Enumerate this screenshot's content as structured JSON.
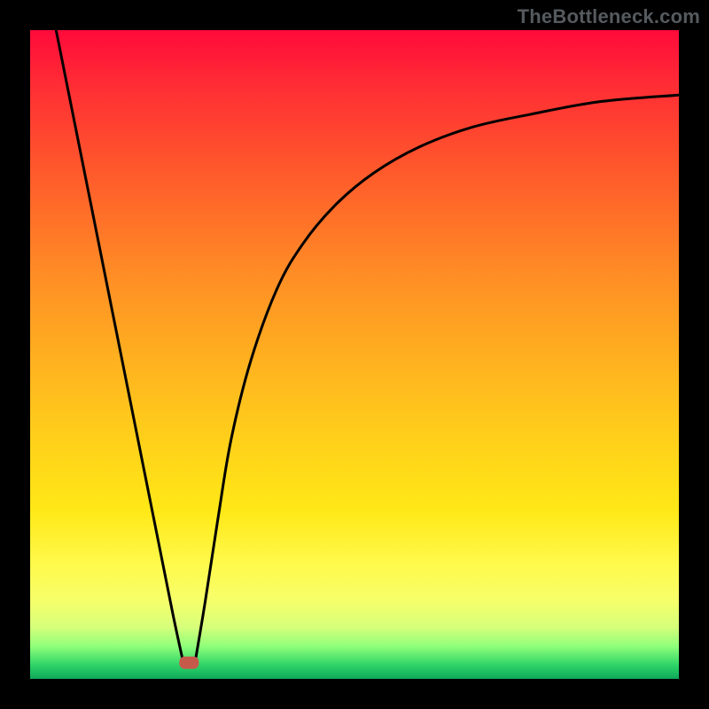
{
  "watermark": "TheBottleneck.com",
  "chart_data": {
    "type": "line",
    "title": "",
    "xlabel": "",
    "ylabel": "",
    "xlim": [
      0,
      100
    ],
    "ylim": [
      0,
      100
    ],
    "grid": false,
    "legend": false,
    "series": [
      {
        "name": "left-branch",
        "x": [
          4,
          6,
          8,
          10,
          12,
          14,
          16,
          18,
          20,
          22,
          23.5
        ],
        "values": [
          100,
          90,
          80,
          70,
          60,
          50,
          40,
          30,
          20,
          10,
          3
        ]
      },
      {
        "name": "right-branch",
        "x": [
          25.5,
          27,
          29,
          31,
          34,
          38,
          42,
          47,
          53,
          60,
          68,
          77,
          88,
          100
        ],
        "values": [
          3,
          12,
          25,
          37,
          49,
          60,
          67,
          73,
          78,
          82,
          85,
          87,
          89,
          90
        ]
      }
    ],
    "marker": {
      "x": 24.5,
      "y": 2.5,
      "color": "#c65a4a",
      "shape": "rounded-rect"
    },
    "gradient_colors": {
      "top": "#ff0a3a",
      "mid1": "#ff8e25",
      "mid2": "#ffe817",
      "bottom": "#0fa85a"
    }
  }
}
